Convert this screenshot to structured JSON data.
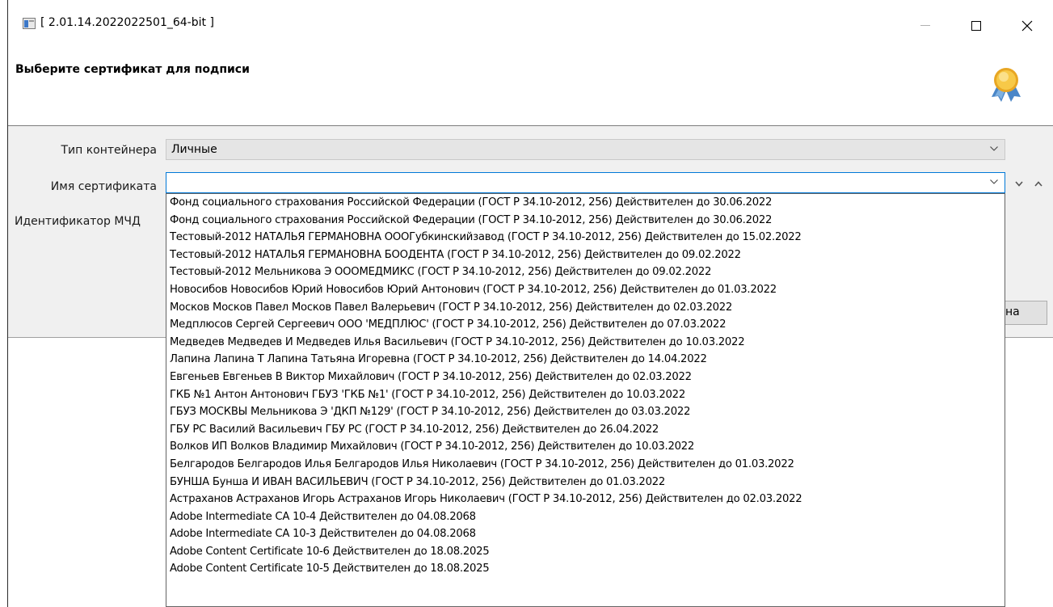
{
  "window": {
    "title": "[ 2.01.14.2022022501_64-bit ]",
    "header_title": "Выберите сертификат для подписи",
    "icons": {
      "app": "app-window-icon",
      "header": "award-ribbon-icon",
      "minimize": "minimize-icon",
      "maximize": "maximize-icon",
      "close": "close-icon"
    }
  },
  "form": {
    "container_type_label": "Тип контейнера",
    "container_type_value": "Личные",
    "cert_name_label": "Имя сертификата",
    "cert_name_value": "",
    "mchd_label": "Идентификатор МЧД",
    "side_button_label": "на"
  },
  "dropdown": {
    "items": [
      "Фонд социального страхования Российской Федерации (ГОСТ Р 34.10-2012, 256) Действителен до 30.06.2022",
      "Фонд социального страхования Российской Федерации (ГОСТ Р 34.10-2012, 256) Действителен до 30.06.2022",
      "Тестовый-2012 НАТАЛЬЯ ГЕРМАНОВНА ОООГубкинскийзавод (ГОСТ Р 34.10-2012, 256) Действителен до 15.02.2022",
      "Тестовый-2012 НАТАЛЬЯ ГЕРМАНОВНА БООДЕНТА (ГОСТ Р 34.10-2012, 256) Действителен до 09.02.2022",
      "Тестовый-2012 Мельникова Э ОООМЕДМИКС (ГОСТ Р 34.10-2012, 256) Действителен до 09.02.2022",
      "Новосибов Новосибов Юрий Новосибов Юрий Антонович (ГОСТ Р 34.10-2012, 256) Действителен до 01.03.2022",
      "Москов Москов Павел Москов Павел Валерьевич (ГОСТ Р 34.10-2012, 256) Действителен до 02.03.2022",
      "Медплюсов Сергей Сергеевич ООО 'МЕДПЛЮС' (ГОСТ Р 34.10-2012, 256) Действителен до 07.03.2022",
      "Медведев Медведев И Медведев Илья Васильевич (ГОСТ Р 34.10-2012, 256) Действителен до 10.03.2022",
      "Лапина Лапина Т Лапина Татьяна Игоревна (ГОСТ Р 34.10-2012, 256) Действителен до 14.04.2022",
      "Евгеньев Евгеньев В Виктор Михайлович (ГОСТ Р 34.10-2012, 256) Действителен до 02.03.2022",
      "ГКБ №1 Антон Антонович ГБУЗ 'ГКБ №1' (ГОСТ Р 34.10-2012, 256) Действителен до 10.03.2022",
      "ГБУЗ МОСКВЫ Мельникова Э 'ДКП №129' (ГОСТ Р 34.10-2012, 256) Действителен до 03.03.2022",
      "ГБУ РС Василий Васильевич ГБУ РС (ГОСТ Р 34.10-2012, 256) Действителен до 26.04.2022",
      "Волков ИП Волков Владимир Михайлович (ГОСТ Р 34.10-2012, 256) Действителен до 10.03.2022",
      "Белгародов Белгародов Илья Белгародов Илья Николаевич (ГОСТ Р 34.10-2012, 256) Действителен до 01.03.2022",
      "БУНША Бунша И ИВАН ВАСИЛЬЕВИЧ (ГОСТ Р 34.10-2012, 256) Действителен до 01.03.2022",
      "Астраханов Астраханов Игорь Астраханов Игорь Николаевич (ГОСТ Р 34.10-2012, 256) Действителен до 02.03.2022",
      "Adobe Intermediate CA 10-4 Действителен до 04.08.2068",
      "Adobe Intermediate CA 10-3 Действителен до 04.08.2068",
      "Adobe Content Certificate 10-6 Действителен до 18.08.2025",
      "Adobe Content Certificate 10-5 Действителен до 18.08.2025"
    ]
  }
}
